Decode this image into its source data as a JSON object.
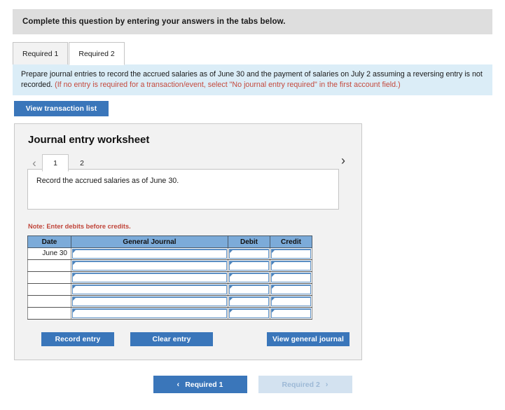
{
  "banner": {
    "text": "Complete this question by entering your answers in the tabs below."
  },
  "tabs": [
    {
      "label": "Required 1",
      "active": false
    },
    {
      "label": "Required 2",
      "active": true
    }
  ],
  "instruction": {
    "main": "Prepare journal entries to record the accrued salaries as of June 30 and the payment of salaries on July 2 assuming a reversing entry is not recorded.",
    "hint": "(If no entry is required for a transaction/event, select \"No journal entry required\" in the first account field.)"
  },
  "toolbar": {
    "view_transaction_list": "View transaction list"
  },
  "worksheet": {
    "title": "Journal entry worksheet",
    "pager": {
      "prev_icon": "‹",
      "next_icon": "›",
      "pages": [
        {
          "label": "1",
          "active": true
        },
        {
          "label": "2",
          "active": false
        }
      ]
    },
    "description": "Record the accrued salaries as of June 30.",
    "note": "Note: Enter debits before credits.",
    "table": {
      "headers": [
        "Date",
        "General Journal",
        "Debit",
        "Credit"
      ],
      "rows": [
        {
          "date": "June 30",
          "general_journal": "",
          "debit": "",
          "credit": ""
        },
        {
          "date": "",
          "general_journal": "",
          "debit": "",
          "credit": ""
        },
        {
          "date": "",
          "general_journal": "",
          "debit": "",
          "credit": ""
        },
        {
          "date": "",
          "general_journal": "",
          "debit": "",
          "credit": ""
        },
        {
          "date": "",
          "general_journal": "",
          "debit": "",
          "credit": ""
        },
        {
          "date": "",
          "general_journal": "",
          "debit": "",
          "credit": ""
        }
      ]
    },
    "actions": {
      "record_entry": "Record entry",
      "clear_entry": "Clear entry",
      "view_general_journal": "View general journal"
    }
  },
  "bottom_nav": {
    "prev": {
      "label": "Required 1",
      "icon": "‹",
      "state": "active"
    },
    "next": {
      "label": "Required 2",
      "icon": "›",
      "state": "disabled"
    }
  },
  "colors": {
    "primary_blue": "#3a76ba",
    "table_header_blue": "#7cabd9",
    "instruction_bg": "#dbedf7",
    "banner_bg": "#dedede",
    "note_red": "#c0453a",
    "disabled_blue": "#d3e2f0"
  }
}
